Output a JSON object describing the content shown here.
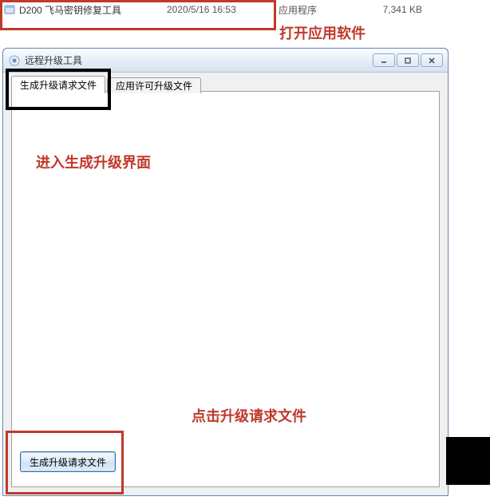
{
  "file_row": {
    "name": "D200 飞马密钥修复工具",
    "date": "2020/5/16 16:53",
    "type": "应用程序",
    "size": "7,341 KB"
  },
  "annotations": {
    "open_app": "打开应用软件",
    "enter_gen": "进入生成升级界面",
    "click_gen": "点击升级请求文件"
  },
  "window": {
    "title": "远程升级工具",
    "tabs": [
      {
        "label": "生成升级请求文件"
      },
      {
        "label": "应用许可升级文件"
      }
    ],
    "button_label": "生成升级请求文件"
  }
}
